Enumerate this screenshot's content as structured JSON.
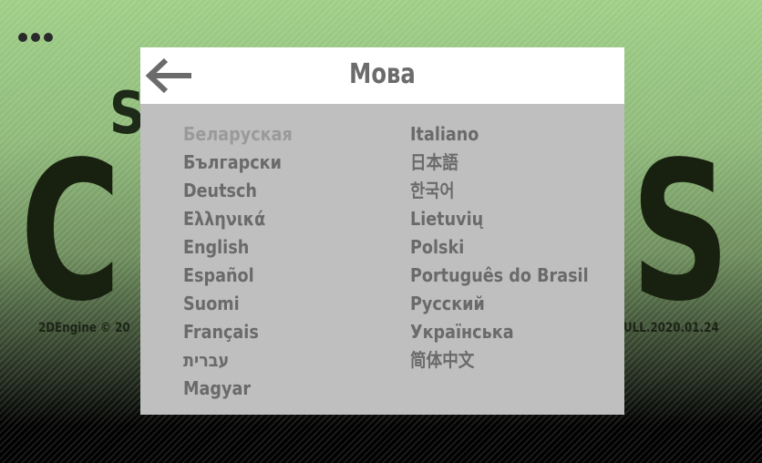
{
  "background": {
    "title_partial_top": "S",
    "title_letter_left": "C",
    "title_letter_right": "S",
    "engine_text": "2DEngine © 20",
    "build_text": "ULL.2020.01.24"
  },
  "dialog": {
    "title": "Мова",
    "back_icon": "arrow-left-icon"
  },
  "languages_left": [
    {
      "label": "Беларуская",
      "current": true
    },
    {
      "label": "Български"
    },
    {
      "label": "Deutsch"
    },
    {
      "label": "Ελληνικά"
    },
    {
      "label": "English"
    },
    {
      "label": "Español"
    },
    {
      "label": "Suomi"
    },
    {
      "label": "Français"
    },
    {
      "label": "עברית"
    },
    {
      "label": "Magyar"
    }
  ],
  "languages_right": [
    {
      "label": "Italiano"
    },
    {
      "label": "日本語"
    },
    {
      "label": "한국어"
    },
    {
      "label": "Lietuvių"
    },
    {
      "label": "Polski"
    },
    {
      "label": "Português do Brasil"
    },
    {
      "label": "Русский"
    },
    {
      "label": "Українська"
    },
    {
      "label": "简体中文"
    }
  ],
  "colors": {
    "dialog_bg": "#bfbfbf",
    "header_bg": "#ffffff",
    "text": "#6a6a6a",
    "text_disabled": "#9a9a9a"
  }
}
